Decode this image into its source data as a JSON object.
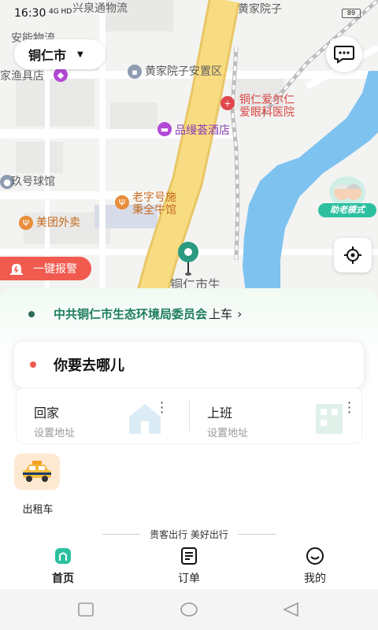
{
  "status_bar": {
    "time": "16:30",
    "signal": "4G HD",
    "battery": "89"
  },
  "map": {
    "labels": [
      "兴泉通物流",
      "黄家院子",
      "安能物流",
      "家渔具店",
      "黄家院子安置区",
      "铜仁爱尔仁",
      "爱眼科医院",
      "品缦荟酒店",
      "玖号球馆",
      "老字号施",
      "秉全牛馆",
      "美团外卖",
      "铜仁市生"
    ]
  },
  "city_selector": {
    "city": "铜仁市"
  },
  "elder_mode": {
    "label": "助老模式"
  },
  "sos": {
    "label": "一键报警"
  },
  "pickup": {
    "place": "中共铜仁市生态环境局委员会",
    "suffix": "上车"
  },
  "destination": {
    "placeholder": "你要去哪儿"
  },
  "shortcuts": [
    {
      "title": "回家",
      "subtitle": "设置地址"
    },
    {
      "title": "上班",
      "subtitle": "设置地址"
    }
  ],
  "services": [
    {
      "label": "出租车",
      "icon": "taxi-icon"
    }
  ],
  "slogan": "贵客出行 美好出行",
  "tabs": [
    {
      "label": "首页",
      "icon": "home-icon",
      "active": true
    },
    {
      "label": "订单",
      "icon": "order-icon",
      "active": false
    },
    {
      "label": "我的",
      "icon": "profile-icon",
      "active": false
    }
  ],
  "colors": {
    "accent": "#2cc0a0",
    "alert": "#f05a4f",
    "pickup_text": "#1c7d5e",
    "river": "#7ec2f0",
    "main_road": "#f6d97a"
  }
}
